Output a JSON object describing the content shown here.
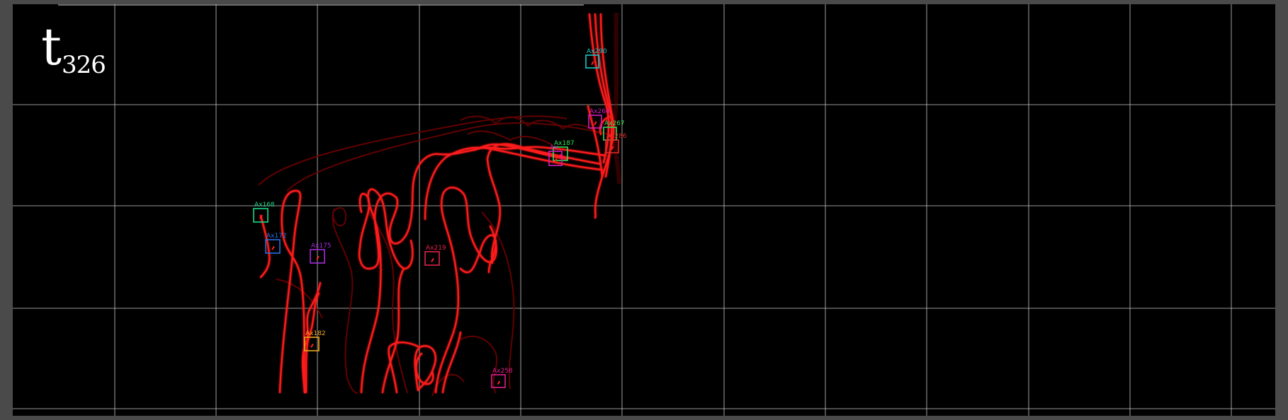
{
  "timestamp": {
    "letter": "t",
    "index": "326"
  },
  "grid_color": "#c8c8c8",
  "axon_color": "#ff1a1a",
  "annotations": [
    {
      "label": "Ax290",
      "color": "#17c9c9"
    },
    {
      "label": "Ax264",
      "color": "#d01fbf"
    },
    {
      "label": "Ax267",
      "color": "#2ee05a"
    },
    {
      "label": "Ax286",
      "color": "#e02b2b"
    },
    {
      "label": "Ax187",
      "color": "#2ee05a"
    },
    {
      "label": "Ax",
      "color": "#d01fbf"
    },
    {
      "label": "Ax168",
      "color": "#19d98a"
    },
    {
      "label": "Ax172",
      "color": "#2a6fe0"
    },
    {
      "label": "Ax175",
      "color": "#a52ad9"
    },
    {
      "label": "Ax219",
      "color": "#e0244b"
    },
    {
      "label": "Ax182",
      "color": "#f0a81a"
    },
    {
      "label": "Ax258",
      "color": "#e01f8e"
    }
  ]
}
